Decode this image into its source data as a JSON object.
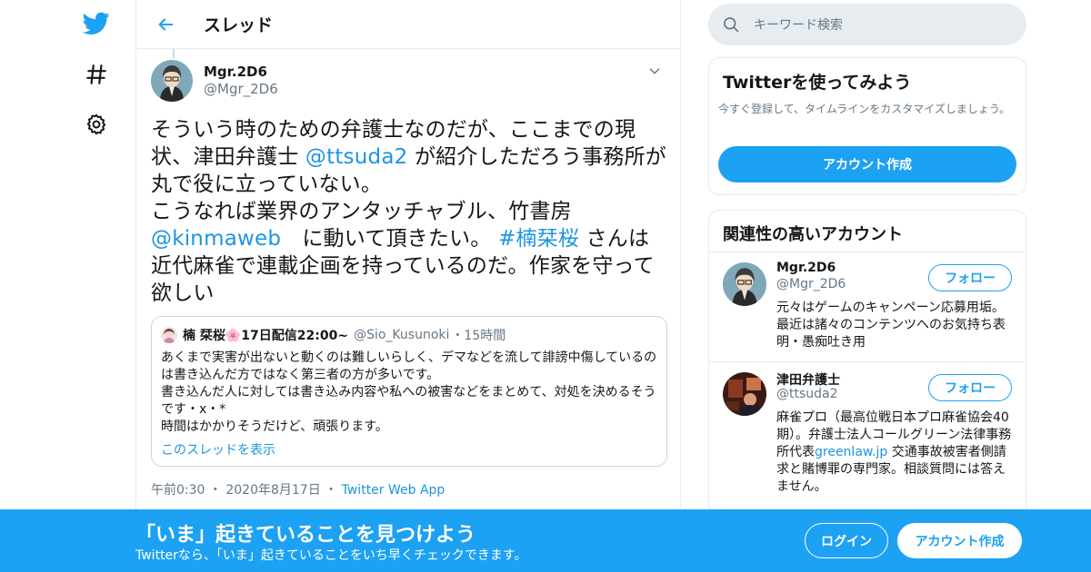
{
  "colors": {
    "accent": "#1da1f2",
    "link": "#1b95e0",
    "muted": "#657786",
    "border": "#e6ecf0"
  },
  "nav": {
    "logo_icon": "twitter-bird-icon",
    "explore_icon": "hashtag-icon",
    "settings_icon": "gear-icon"
  },
  "header": {
    "back_icon": "arrow-left-icon",
    "title": "スレッド"
  },
  "tweet": {
    "author_name": "Mgr.2D6",
    "author_handle": "@Mgr_2D6",
    "text_1": "そういう時のための弁護士なのだが、ここまでの現状、津田弁護士 ",
    "mention_1": "@ttsuda2",
    "text_2": " が紹介しただろう事務所が丸で役に立っていない。",
    "text_3": "こうなれば業界のアンタッチャブル、竹書房 ",
    "mention_2": "@kinmaweb",
    "text_4": "　に動いて頂きたい。 ",
    "hashtag": "#楠栞桜",
    "text_5": " さんは近代麻雀で連載企画を持っているのだ。作家を守って欲しい",
    "time": "午前0:30",
    "date": "2020年8月17日",
    "source": "Twitter Web App",
    "separator": "・"
  },
  "quote": {
    "name": "楠 栞桜🌸17日配信22:00~",
    "handle": "@Sio_Kusunoki",
    "separator": "・",
    "time_ago": "15時間",
    "line_1": "あくまで実害が出ないと動くのは難しいらしく、デマなどを流して誹謗中傷しているのは書き込んだ方ではなく第三者の方が多いです。",
    "line_2": "書き込んだ人に対しては書き込み内容や私への被害などをまとめて、対処を決めるそうです・x・*",
    "line_3": "時間はかかりそうだけど、頑張ります。",
    "show_thread": "このスレッドを表示"
  },
  "search": {
    "placeholder": "キーワード検索"
  },
  "signup_card": {
    "title": "Twitterを使ってみよう",
    "subtitle": "今すぐ登録して、タイムラインをカスタマイズしましょう。",
    "button": "アカウント作成"
  },
  "related": {
    "title": "関連性の高いアカウント",
    "accounts": [
      {
        "name": "Mgr.2D6",
        "handle": "@Mgr_2D6",
        "follow": "フォロー",
        "bio": "元々はゲームのキャンペーン応募用垢。最近は諸々のコンテンツへのお気持ち表明・愚痴吐き用"
      },
      {
        "name": "津田弁護士",
        "handle": "@ttsuda2",
        "follow": "フォロー",
        "bio_1": "麻雀プロ（最高位戦日本プロ麻雀協会40期）。弁護士法人コールグリーン法律事務所代表",
        "bio_link": "greenlaw.jp",
        "bio_2": " 交通事故被害者側請求と賭博罪の専門家。相談質問には答えません。"
      }
    ]
  },
  "banner": {
    "title": "「いま」起きていることを見つけよう",
    "subtitle": "Twitterなら、「いま」起きていることをいち早くチェックできます。",
    "login": "ログイン",
    "signup": "アカウント作成"
  }
}
